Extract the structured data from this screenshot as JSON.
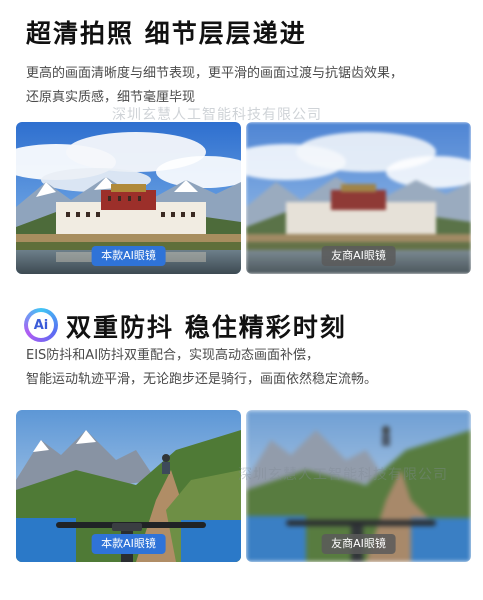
{
  "section_clarity": {
    "title": "超清拍照 细节层层递进",
    "desc_line1": "更高的画面清晰度与细节表现，更平滑的画面过渡与抗锯齿效果，",
    "desc_line2": "还原真实质感，细节毫厘毕现",
    "watermark": "深圳玄慧人工智能科技有限公司",
    "left_label": "本款AI眼镜",
    "right_label": "友商AI眼镜"
  },
  "section_stabilize": {
    "logo_text": "Ai",
    "title": "双重防抖 稳住精彩时刻",
    "desc_line1": "EIS防抖和AI防抖双重配合，实现高动态画面补偿，",
    "desc_line2": "智能运动轨迹平滑，无论跑步还是骑行，画面依然稳定流畅。",
    "watermark": "深圳玄慧人工智能科技有限公司",
    "left_label": "本款AI眼镜",
    "right_label": "友商AI眼镜"
  },
  "colors": {
    "accent_blue": "#2f73d8",
    "badge_gray": "#5a5a5a",
    "title_text": "#111111",
    "desc_text": "#4a4a4a"
  }
}
